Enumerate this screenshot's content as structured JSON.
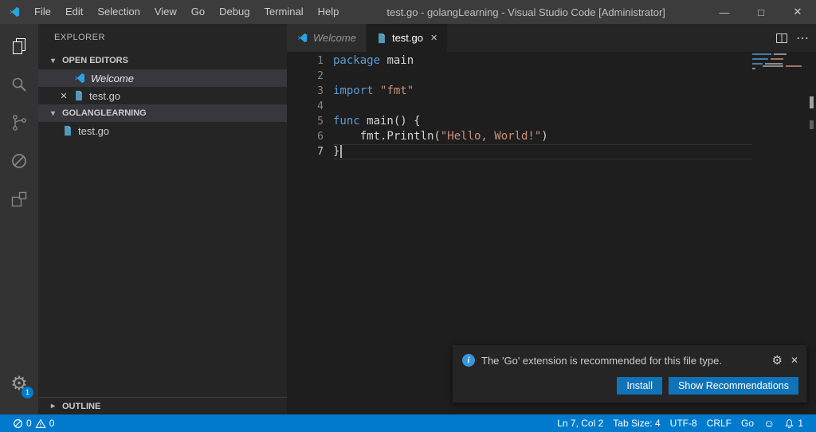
{
  "window": {
    "title": "test.go - golangLearning - Visual Studio Code [Administrator]",
    "minimize_glyph": "—",
    "maximize_glyph": "□",
    "close_glyph": "✕"
  },
  "menu": {
    "items": [
      "File",
      "Edit",
      "Selection",
      "View",
      "Go",
      "Debug",
      "Terminal",
      "Help"
    ]
  },
  "activity": {
    "gear_glyph": "⚙",
    "badge": "1"
  },
  "sidebar": {
    "title": "EXPLORER",
    "open_editors_label": "OPEN EDITORS",
    "welcome_label": "Welcome",
    "open_file_label": "test.go",
    "folder_label": "GOLANGLEARNING",
    "folder_file_label": "test.go",
    "outline_label": "OUTLINE",
    "collapse_glyph": "▾",
    "expand_glyph": "▸",
    "close_glyph": "✕"
  },
  "tabs": {
    "welcome_label": "Welcome",
    "active_label": "test.go",
    "close_glyph": "✕",
    "more_glyph": "⋯"
  },
  "editor": {
    "colors": {
      "keyword": "#569cd6",
      "string": "#ce9178",
      "plain": "#d4d4d4",
      "background": "#1e1e1e"
    },
    "lines": [
      {
        "n": 1,
        "tokens": [
          {
            "t": "package",
            "c": "kw"
          },
          {
            "t": " main",
            "c": "pl"
          }
        ]
      },
      {
        "n": 2,
        "tokens": []
      },
      {
        "n": 3,
        "tokens": [
          {
            "t": "import ",
            "c": "kw"
          },
          {
            "t": "\"fmt\"",
            "c": "str"
          }
        ]
      },
      {
        "n": 4,
        "tokens": []
      },
      {
        "n": 5,
        "tokens": [
          {
            "t": "func",
            "c": "kw"
          },
          {
            "t": " main() {",
            "c": "pl"
          }
        ]
      },
      {
        "n": 6,
        "tokens": [
          {
            "t": "    fmt.Println(",
            "c": "pl"
          },
          {
            "t": "\"Hello, World!\"",
            "c": "str"
          },
          {
            "t": ")",
            "c": "pl"
          }
        ]
      },
      {
        "n": 7,
        "tokens": [
          {
            "t": "}",
            "c": "pl"
          }
        ]
      }
    ]
  },
  "notification": {
    "message": "The 'Go' extension is recommended for this file type.",
    "info_glyph": "i",
    "gear_glyph": "⚙",
    "close_glyph": "✕",
    "install_label": "Install",
    "recommendations_label": "Show Recommendations"
  },
  "status": {
    "errors": "0",
    "warnings": "0",
    "cursor_position": "Ln 7, Col 2",
    "tab_size": "Tab Size: 4",
    "encoding": "UTF-8",
    "eol": "CRLF",
    "language": "Go",
    "smiley_glyph": "☺",
    "bell_count": "1",
    "accent": "#007acc"
  }
}
